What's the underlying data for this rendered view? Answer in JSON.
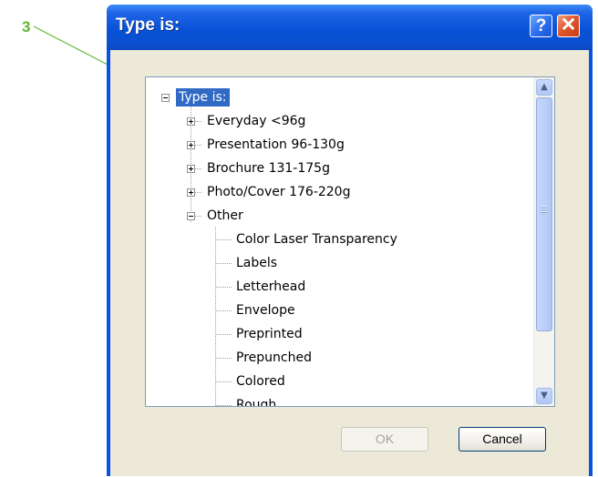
{
  "callout": {
    "number": "3",
    "color": "#66b32e"
  },
  "dialog": {
    "title": "Type is:",
    "help_label": "?",
    "close_label": "✕",
    "ok_label": "OK",
    "cancel_label": "Cancel"
  },
  "tree": {
    "root": {
      "label": "Type is:",
      "expanded": true,
      "selected": true
    },
    "items": [
      {
        "label": "Everyday <96g",
        "expanded": false
      },
      {
        "label": "Presentation 96-130g",
        "expanded": false
      },
      {
        "label": "Brochure 131-175g",
        "expanded": false
      },
      {
        "label": "Photo/Cover 176-220g",
        "expanded": false
      },
      {
        "label": "Other",
        "expanded": true
      }
    ],
    "other_children": [
      "Color Laser Transparency",
      "Labels",
      "Letterhead",
      "Envelope",
      "Preprinted",
      "Prepunched",
      "Colored",
      "Rough"
    ]
  },
  "icons": {
    "scroll_up": "scroll-up-arrow-icon",
    "scroll_down": "scroll-down-arrow-icon",
    "collapse": "collapse-minus-icon",
    "expand": "expand-plus-icon"
  },
  "colors": {
    "title_bar": "#0852d8",
    "selection": "#316ac5",
    "dialog_face": "#ece9d8"
  }
}
